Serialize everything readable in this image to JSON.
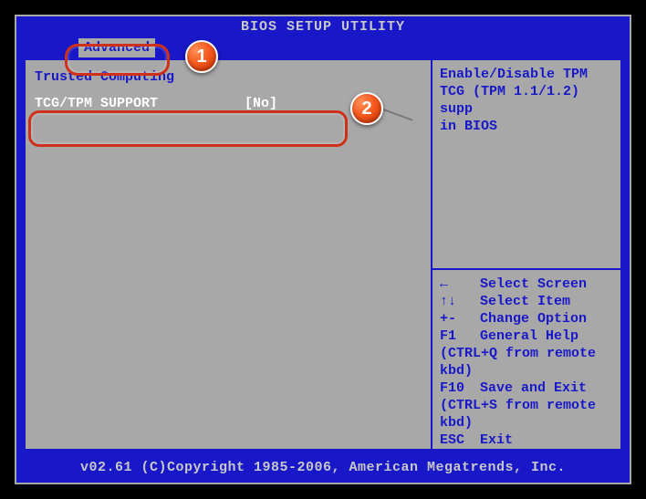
{
  "title": "BIOS SETUP UTILITY",
  "tab": {
    "label": "Advanced"
  },
  "left": {
    "section": "Trusted Computing",
    "option": {
      "label": "TCG/TPM SUPPORT",
      "value": "[No]"
    }
  },
  "help": {
    "line1": "Enable/Disable TPM",
    "line2": "TCG (TPM 1.1/1.2) supp",
    "line3": "in BIOS"
  },
  "nav": {
    "arrow_lr": "←",
    "select_screen": "Select Screen",
    "arrow_ud": "↑↓",
    "select_item": "Select Item",
    "plusminus": "+-",
    "change_option": "Change Option",
    "f1": "F1",
    "general_help": "General Help",
    "note1": "(CTRL+Q from remote kbd)",
    "f10": "F10",
    "save_exit": "Save and Exit",
    "note2": "(CTRL+S from remote kbd)",
    "esc": "ESC",
    "exit": "Exit"
  },
  "footer": "v02.61 (C)Copyright 1985-2006, American Megatrends, Inc.",
  "annotations": {
    "b1": "1",
    "b2": "2"
  }
}
